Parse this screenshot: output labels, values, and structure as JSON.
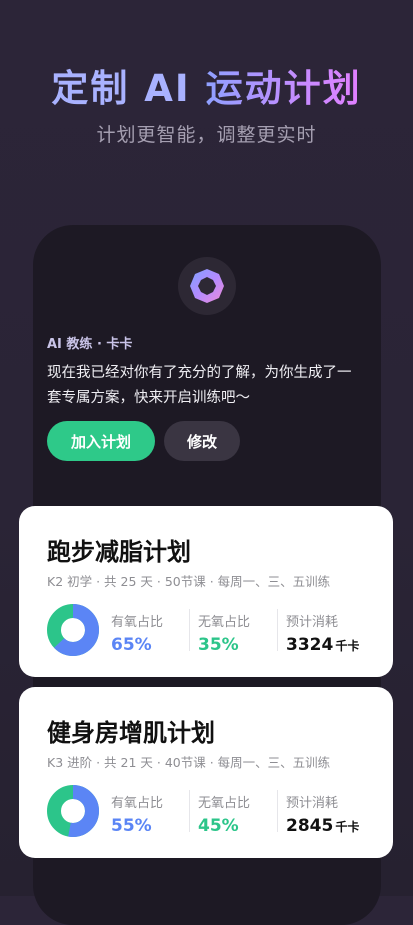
{
  "hero": {
    "title_part1": "定制 AI ",
    "title_part2": "运动计划",
    "subtitle": "计划更智能，调整更实时"
  },
  "coach": {
    "name": "AI 教练 · 卡卡",
    "message": "现在我已经对你有了充分的了解，为你生成了一套专属方案，快来开启训练吧～",
    "join_button": "加入计划",
    "edit_button": "修改",
    "colors": {
      "join": "#2ec989",
      "edit": "#3a3542"
    }
  },
  "plans": [
    {
      "title": "跑步减脂计划",
      "meta": "K2 初学 · 共 25 天 · 50节课 · 每周一、三、五训练",
      "aerobic_label": "有氧占比",
      "aerobic_value": "65%",
      "anaerobic_label": "无氧占比",
      "anaerobic_value": "35%",
      "calorie_label": "预计消耗",
      "calorie_value": "3324",
      "calorie_unit": "千卡",
      "aerobic_fraction": 0.65
    },
    {
      "title": "健身房增肌计划",
      "meta": "K3 进阶 · 共 21 天 · 40节课 · 每周一、三、五训练",
      "aerobic_label": "有氧占比",
      "aerobic_value": "55%",
      "anaerobic_label": "无氧占比",
      "anaerobic_value": "45%",
      "calorie_label": "预计消耗",
      "calorie_value": "2845",
      "calorie_unit": "千卡",
      "aerobic_fraction": 0.55
    }
  ],
  "colors": {
    "aerobic": "#5b85f5",
    "anaerobic": "#2cc58a"
  }
}
